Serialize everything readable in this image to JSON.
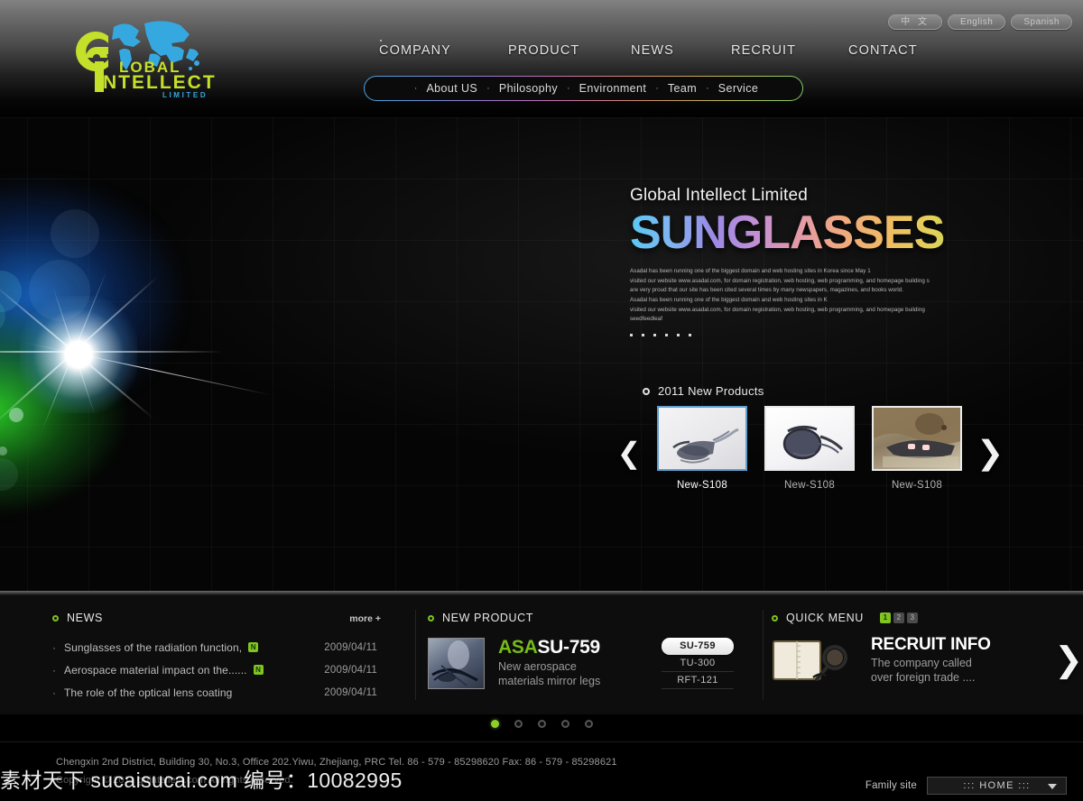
{
  "header": {
    "languages": [
      {
        "label": "中 文",
        "name": "lang-chinese"
      },
      {
        "label": "English",
        "name": "lang-english"
      },
      {
        "label": "Spanish",
        "name": "lang-spanish"
      }
    ],
    "logo": {
      "letters": "GI",
      "word_top": "LOBAL",
      "word_mid": "NTELLECT",
      "word_bottom": "LIMITED",
      "color_green": "#c5e02a",
      "color_blue": "#39a9e0"
    },
    "nav": [
      {
        "label": "COMPANY"
      },
      {
        "label": "PRODUCT"
      },
      {
        "label": "NEWS"
      },
      {
        "label": "RECRUIT"
      },
      {
        "label": "CONTACT"
      }
    ],
    "submenu": [
      {
        "label": "About US"
      },
      {
        "label": "Philosophy"
      },
      {
        "label": "Environment"
      },
      {
        "label": "Team"
      },
      {
        "label": "Service"
      }
    ],
    "submenu_bullet": "·"
  },
  "hero": {
    "kicker": "Global Intellect Limited",
    "title": "SUNGLASSES",
    "body": "Asadal has been running one of the biggest domain and web hosting sites in Korea since May 1\nvisited our website www.asadal.com, for domain registration, web hosting, web programming, and homepage building s\nare very proud that  our site has been cited several times by many newspapers, magazines, and books  world.\nAsadal has been running one of the biggest domain and web hosting sites in K\nvisited our website www.asadal.com, for domain registration, web hosting, web programming, and homepage building seedfeedleaf",
    "dot_count": 6,
    "carousel": {
      "title": "2011 New Products",
      "prev_icon": "chevron-left-icon",
      "next_icon": "chevron-right-icon",
      "items": [
        {
          "caption": "New-S108",
          "active": true
        },
        {
          "caption": "New-S108",
          "active": false
        },
        {
          "caption": "New-S108",
          "active": false
        }
      ]
    }
  },
  "panels": {
    "news": {
      "title": "NEWS",
      "more_label": "more +",
      "items": [
        {
          "text": "Sunglasses of the radiation function,",
          "badge": "N",
          "date": "2009/04/11"
        },
        {
          "text": "Aerospace material impact on the......",
          "badge": "N",
          "date": "2009/04/11"
        },
        {
          "text": "The role of the optical lens coating",
          "badge": "",
          "date": "2009/04/11"
        }
      ]
    },
    "new_product": {
      "title": "NEW PRODUCT",
      "brand": "ASA",
      "code": "SU-759",
      "desc_line1": "New aerospace",
      "desc_line2": "materials mirror legs",
      "codes": [
        {
          "label": "SU-759",
          "active": true
        },
        {
          "label": "TU-300",
          "active": false
        },
        {
          "label": "RFT-121",
          "active": false
        }
      ]
    },
    "quick_menu": {
      "title": "QUICK MENU",
      "pager": [
        {
          "label": "1",
          "active": true
        },
        {
          "label": "2",
          "active": false
        },
        {
          "label": "3",
          "active": false
        }
      ],
      "item_title": "RECRUIT INFO",
      "item_sub_line1": "The company called",
      "item_sub_line2": "over foreign trade ....",
      "arrow_icon": "chevron-right-icon"
    }
  },
  "page_dots": {
    "count": 5,
    "active_index": 0
  },
  "footer": {
    "address": "Chengxin 2nd  District, Building 30, No.3, Office 202.Yiwu, Zhejiang, PRC  Tel. 86 - 579 - 85298620    Fax: 86 - 579 - 85298621",
    "copyright": "Copyright © 2011  gbintellect.com All rights reserved.",
    "family_label": "Family site",
    "family_value": "::: HOME :::"
  },
  "watermark": "素材天下 sucaisucai.com 编号：10082995"
}
